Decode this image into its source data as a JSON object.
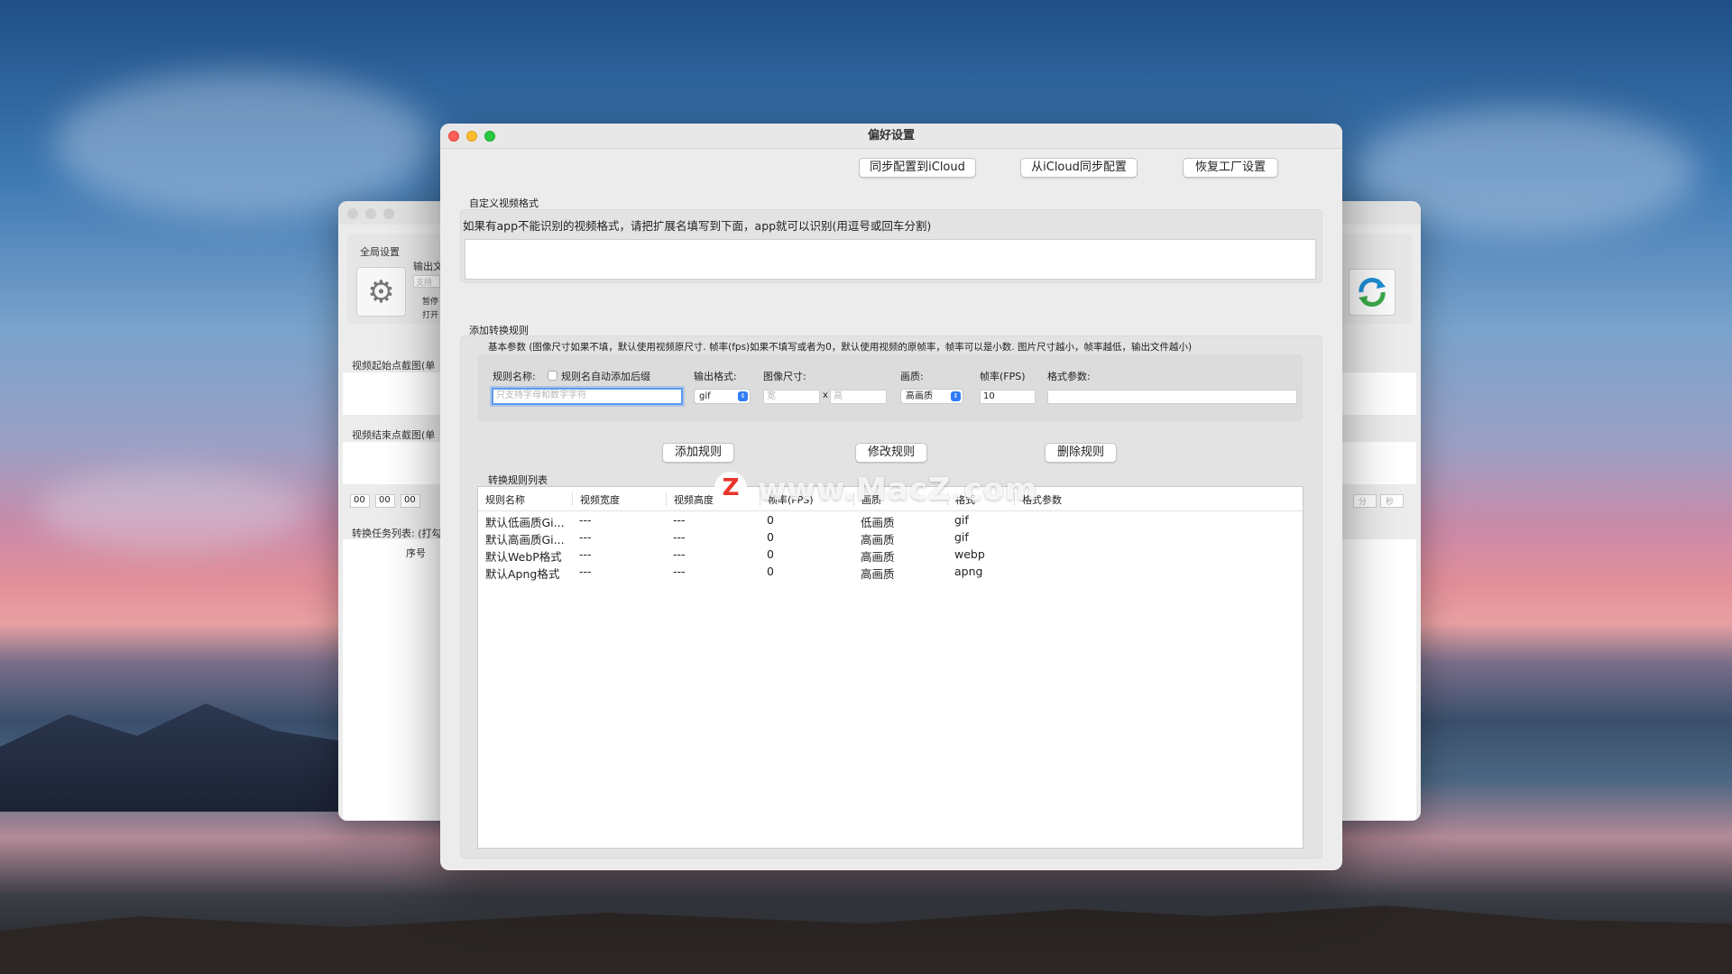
{
  "window": {
    "title": "偏好设置",
    "buttons": {
      "sync_to_icloud": "同步配置到iCloud",
      "sync_from_icloud": "从iCloud同步配置",
      "restore_factory": "恢复工厂设置"
    }
  },
  "custom_format": {
    "section_title": "自定义视频格式",
    "hint": "如果有app不能识别的视频格式，请把扩展名填写到下面，app就可以识别(用逗号或回车分割)",
    "value": ""
  },
  "add_rule": {
    "section_title": "添加转换规则",
    "hint": "基本参数 (图像尺寸如果不填，默认使用视频原尺寸. 帧率(fps)如果不填写或者为0，默认使用视频的原帧率，帧率可以是小数. 图片尺寸越小，帧率越低，输出文件越小)",
    "rule_name_label": "规则名称:",
    "auto_suffix_label": "规则名自动添加后缀",
    "rule_name_placeholder": "只支持字母和数字字符",
    "output_format_label": "输出格式:",
    "output_format_value": "gif",
    "image_size_label": "图像尺寸:",
    "width_placeholder": "宽",
    "x_label": "x",
    "height_placeholder": "高",
    "quality_label": "画质:",
    "quality_value": "高画质",
    "fps_label": "帧率(FPS)",
    "fps_value": "10",
    "format_params_label": "格式参数:",
    "format_params_value": "",
    "add_button": "添加规则",
    "modify_button": "修改规则",
    "delete_button": "删除规则"
  },
  "rules_table": {
    "title": "转换规则列表",
    "columns": [
      "规则名称",
      "视频宽度",
      "视频高度",
      "帧率(FPS)",
      "画质",
      "格式",
      "格式参数"
    ],
    "rows": [
      {
        "name": "默认低画质Gi...",
        "width": "---",
        "height": "---",
        "fps": "0",
        "quality": "低画质",
        "format": "gif",
        "params": ""
      },
      {
        "name": "默认高画质Gi...",
        "width": "---",
        "height": "---",
        "fps": "0",
        "quality": "高画质",
        "format": "gif",
        "params": ""
      },
      {
        "name": "默认WebP格式",
        "width": "---",
        "height": "---",
        "fps": "0",
        "quality": "高画质",
        "format": "webp",
        "params": ""
      },
      {
        "name": "默认Apng格式",
        "width": "---",
        "height": "---",
        "fps": "0",
        "quality": "高画质",
        "format": "apng",
        "params": ""
      }
    ]
  },
  "background_window": {
    "global_settings": "全局设置",
    "output_label": "输出文",
    "placeholder_fragment": "支持",
    "pause_label": "暂停",
    "open_label": "打开",
    "start_frame_label": "视频起始点截图(单",
    "end_frame_label": "视频结束点截图(单",
    "time_values": [
      "00",
      "00",
      "00"
    ],
    "right_time_labels": [
      "分",
      "秒"
    ],
    "task_list_label": "转换任务列表: (打勾",
    "seq_label": "序号"
  },
  "watermark": {
    "logo": "Z",
    "text": "www.MacZ.com"
  },
  "colors": {
    "accent": "#2f7cf6",
    "focus_ring": "#5b9bef",
    "close": "#ff5f57",
    "minimize": "#febc2e",
    "zoom": "#28c840"
  },
  "icons": [
    "gear-icon",
    "sync-icon",
    "chevron-updown-icon"
  ]
}
